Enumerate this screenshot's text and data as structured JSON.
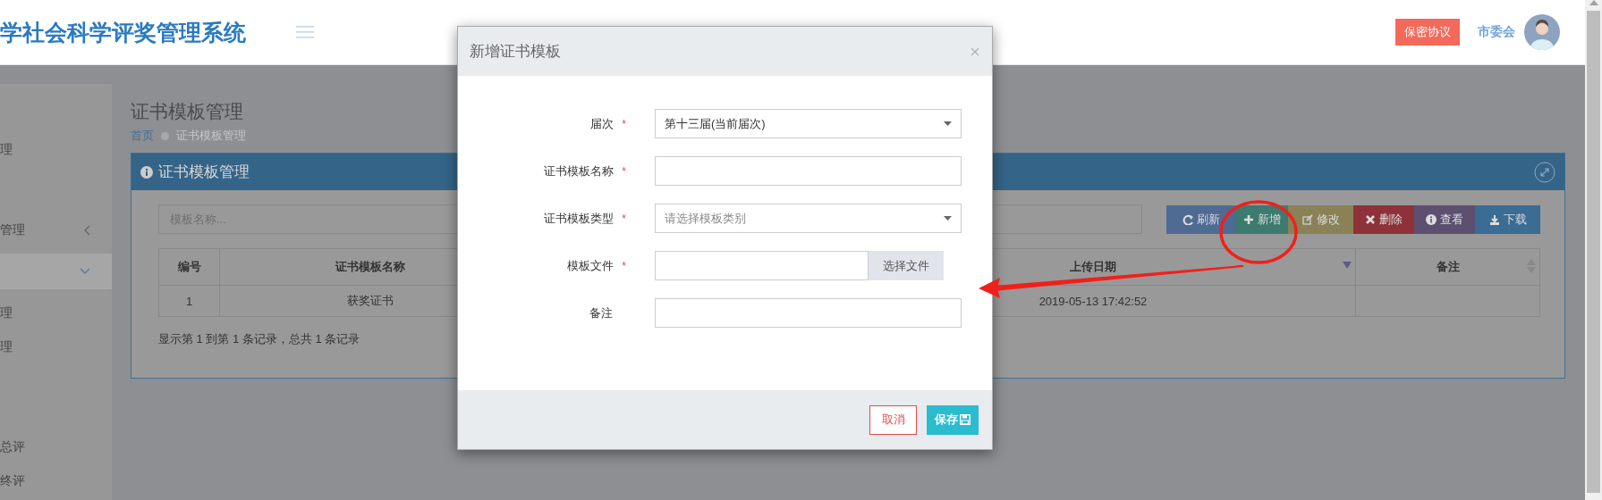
{
  "header": {
    "title": "学社会科学评奖管理系统",
    "agreement_button": "保密协议",
    "user_name": "市委会"
  },
  "sidebar": {
    "items": [
      {
        "label": "理",
        "selected": false
      },
      {
        "label": "管理",
        "selected": false,
        "expanded": false
      },
      {
        "selected": true,
        "expanded": true
      },
      {
        "label": "理",
        "selected": false
      },
      {
        "label": "理",
        "selected": false
      },
      {
        "label": "总评",
        "selected": false
      },
      {
        "label": "终评",
        "selected": false
      }
    ]
  },
  "page": {
    "title": "证书模板管理",
    "breadcrumb": [
      "首页",
      "证书模板管理"
    ],
    "panel": {
      "title": "证书模板管理",
      "search": {
        "placeholder": "模板名称..."
      },
      "toolbar": [
        {
          "kind": "refresh",
          "label": "刷新"
        },
        {
          "kind": "add",
          "label": "新增"
        },
        {
          "kind": "edit",
          "label": "修改"
        },
        {
          "kind": "delete",
          "label": "删除"
        },
        {
          "kind": "view",
          "label": "查看"
        },
        {
          "kind": "download",
          "label": "下载"
        }
      ],
      "table": {
        "columns": [
          {
            "label": "编号",
            "sortable": false
          },
          {
            "label": "证书模板名称",
            "sortable": false
          },
          {
            "label": "上传日期",
            "sortable": true,
            "sorted": true
          },
          {
            "label": "备注",
            "sortable": true,
            "sorted": false
          }
        ],
        "rows": [
          [
            "1",
            "获奖证书",
            "2019-05-13 17:42:52",
            ""
          ]
        ]
      },
      "footer": "显示第 1 到第 1 条记录，总共 1 条记录"
    }
  },
  "dialog": {
    "title": "新增证书模板",
    "fields": [
      {
        "kind": "select",
        "label": "届次",
        "required_mark": "*",
        "value": "第十三届(当前届次)"
      },
      {
        "kind": "text",
        "label": "证书模板名称",
        "required_mark": "*"
      },
      {
        "kind": "select",
        "label": "证书模板类型",
        "required_mark": "*",
        "placeholder": "请选择模板类别"
      },
      {
        "kind": "file",
        "label": "模板文件",
        "required_mark": "*",
        "button": "选择文件"
      },
      {
        "kind": "text",
        "label": "备注"
      }
    ],
    "cancel_button": "取消",
    "save_button": "保存"
  }
}
